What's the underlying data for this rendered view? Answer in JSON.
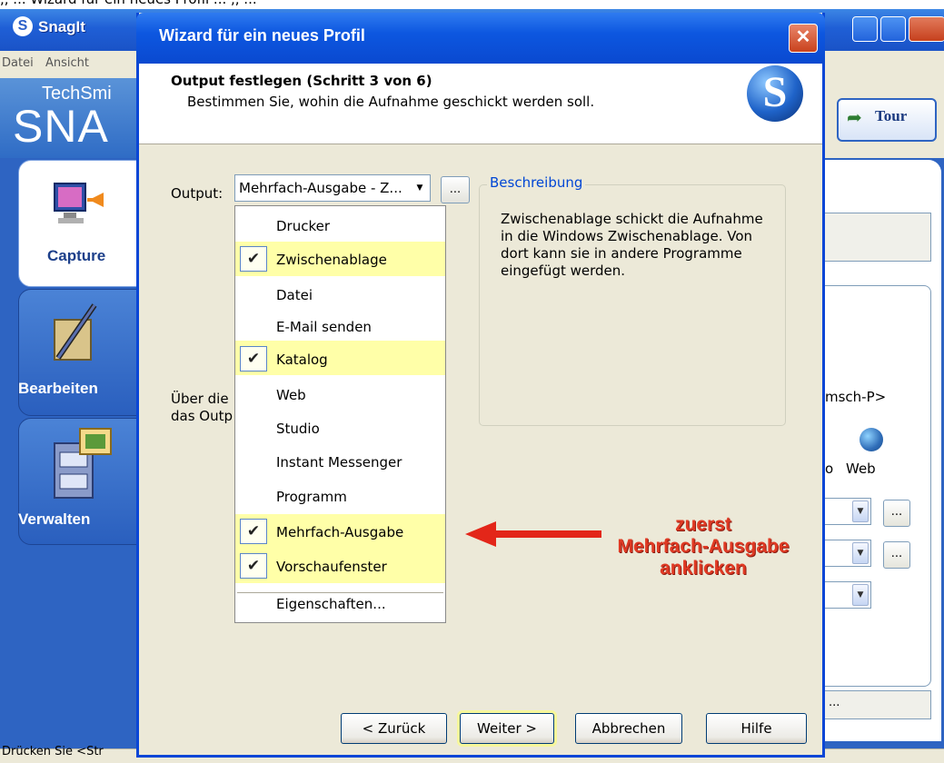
{
  "top_caption": ",, ... Wizard für ein neues Profil ... ,, ...",
  "snagit": {
    "title": "SnagIt",
    "menu": [
      "Datei",
      "Ansicht"
    ],
    "banner_top": "TechSmi",
    "banner_main": "SNA",
    "sidebar": [
      {
        "label": "Capture"
      },
      {
        "label": "Bearbeiten"
      },
      {
        "label": "Verwalten"
      }
    ],
    "tour_label": "Tour",
    "shortcut_fragment": "msch-P>",
    "web_label": "Web",
    "web_prefix": "o",
    "dots": "...",
    "status_text": "Drücken Sie  <Str"
  },
  "wizard": {
    "title": "Wizard für ein neues Profil",
    "step_title": "Output festlegen (Schritt 3 von 6)",
    "step_desc": "Bestimmen Sie, wohin die Aufnahme geschickt werden soll.",
    "output_label": "Output:",
    "output_value": "Mehrfach-Ausgabe - Z...",
    "output_dots": "...",
    "desc_legend": "Beschreibung",
    "desc_text": "Zwischenablage schickt die Aufnahme in die Windows Zwischenablage. Von dort kann sie in andere Programme eingefügt werden.",
    "ueber_line1": "Über die",
    "ueber_line2": "das Outp",
    "menu_items": [
      {
        "label": "Drucker",
        "checked": false
      },
      {
        "label": "Zwischenablage",
        "checked": true
      },
      {
        "label": "Datei",
        "checked": false
      },
      {
        "label": "E-Mail senden",
        "checked": false
      },
      {
        "label": "Katalog",
        "checked": true
      },
      {
        "label": "Web",
        "checked": false
      },
      {
        "label": "Studio",
        "checked": false
      },
      {
        "label": "Instant Messenger",
        "checked": false
      },
      {
        "label": "Programm",
        "checked": false
      },
      {
        "label": "Mehrfach-Ausgabe",
        "checked": true
      },
      {
        "label": "Vorschaufenster",
        "checked": true
      },
      {
        "label": "Eigenschaften...",
        "checked": false
      }
    ],
    "buttons": {
      "back": "< Zurück",
      "next": "Weiter >",
      "cancel": "Abbrechen",
      "help": "Hilfe"
    }
  },
  "annotation": {
    "line1": "zuerst",
    "line2": "Mehrfach-Ausgabe",
    "line3": "anklicken",
    "color": "#e03a24"
  },
  "colors": {
    "xp_blue": "#0a49d0",
    "highlight_yellow": "#ffffa8"
  }
}
